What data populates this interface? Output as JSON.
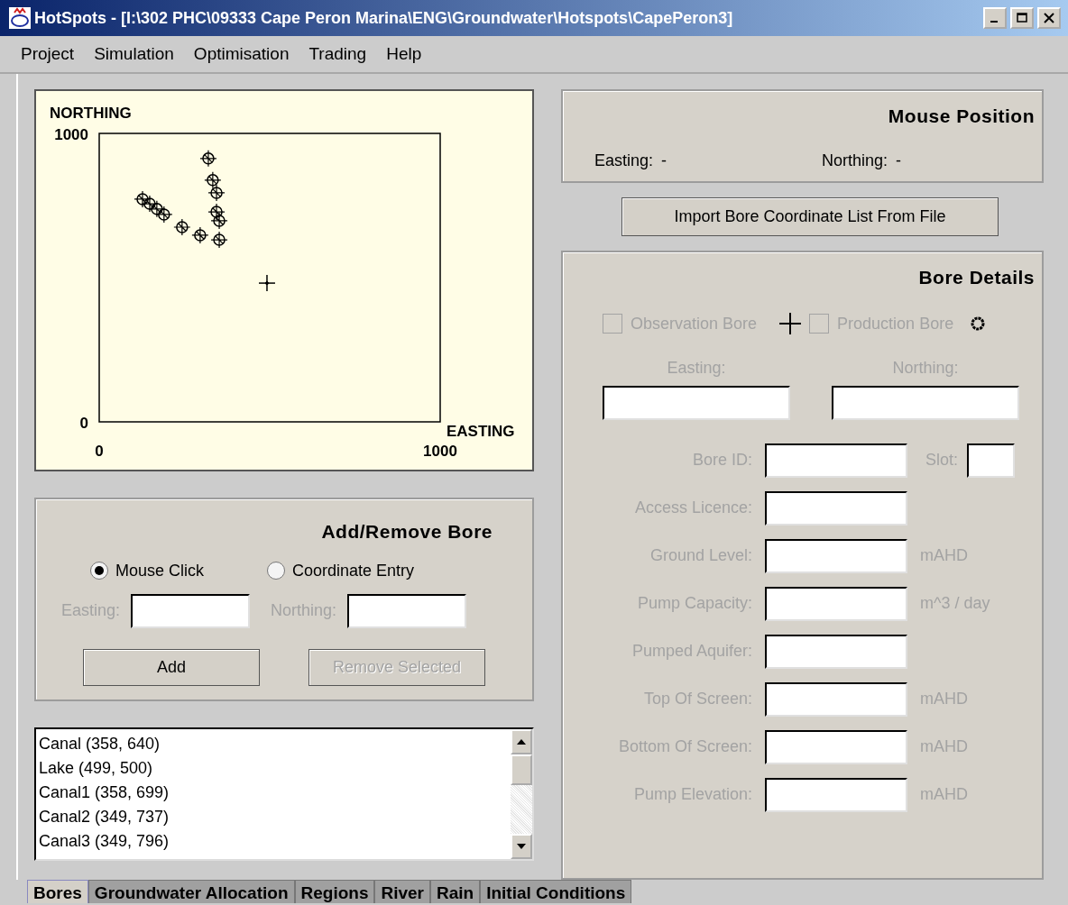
{
  "window": {
    "title": "HotSpots - [I:\\302 PHC\\09333 Cape Peron Marina\\ENG\\Groundwater\\Hotspots\\CapePeron3]"
  },
  "menu": [
    "Project",
    "Simulation",
    "Optimisation",
    "Trading",
    "Help"
  ],
  "plot": {
    "chart_data": {
      "type": "scatter",
      "xlabel": "EASTING",
      "ylabel": "NORTHING",
      "xlim": [
        0,
        1000
      ],
      "ylim": [
        0,
        1000
      ],
      "xticks": [
        0,
        1000
      ],
      "yticks": [
        0,
        1000
      ],
      "series": [
        {
          "color": "#000000",
          "x": [
            320,
            333,
            344,
            344,
            352,
            352,
            296,
            243,
            190,
            169,
            148,
            127
          ],
          "values": [
            913,
            838,
            794,
            728,
            697,
            631,
            647,
            675,
            719,
            738,
            756,
            772
          ]
        },
        {
          "color": "#000000",
          "x": [
            492
          ],
          "values": [
            481
          ]
        }
      ]
    },
    "markers": [
      {
        "kind": "production"
      },
      {
        "kind": "observation"
      }
    ]
  },
  "add_remove": {
    "title": "Add/Remove Bore",
    "modes": [
      {
        "label": "Mouse Click",
        "selected": true
      },
      {
        "label": "Coordinate Entry",
        "selected": false
      }
    ],
    "coordinates_disabled": true,
    "easting_label": "Easting:",
    "northing_label": "Northing:",
    "buttons": [
      {
        "label": "Add",
        "disabled": false
      },
      {
        "label": "Remove Selected",
        "disabled": true
      }
    ]
  },
  "bore_list": {
    "items": [
      "Canal (358, 640)",
      "Lake (499, 500)",
      "Canal1 (358, 699)",
      "Canal2 (349, 737)",
      "Canal3 (349, 796)"
    ]
  },
  "mouse_position": {
    "title": "Mouse Position",
    "easting_label": "Easting:",
    "easting": "-",
    "northing_label": "Northing:",
    "northing": "-"
  },
  "import_button": "Import Bore Coordinate List From File",
  "bore_details": {
    "title": "Bore Details",
    "disabled": true,
    "bore_types": [
      {
        "label": "Observation Bore",
        "checked": false,
        "kind": "observation"
      },
      {
        "label": "Production Bore",
        "checked": false,
        "kind": "production"
      }
    ],
    "easting_label": "Easting:",
    "northing_label": "Northing:",
    "fields": [
      {
        "label": "Bore ID:",
        "slot_label": "Slot:"
      },
      {
        "label": "Access Licence:"
      },
      {
        "label": "Ground Level:",
        "unit": "mAHD"
      },
      {
        "label": "Pump Capacity:",
        "unit": "m^3 / day"
      },
      {
        "label": "Pumped Aquifer:"
      },
      {
        "label": "Top Of Screen:",
        "unit": "mAHD"
      },
      {
        "label": "Bottom Of Screen:",
        "unit": "mAHD"
      },
      {
        "label": "Pump Elevation:",
        "unit": "mAHD"
      }
    ]
  },
  "tabs": [
    {
      "label": "Bores",
      "selected": true
    },
    {
      "label": "Groundwater Allocation",
      "selected": false
    },
    {
      "label": "Regions",
      "selected": false
    },
    {
      "label": "River",
      "selected": false
    },
    {
      "label": "Rain",
      "selected": false
    },
    {
      "label": "Initial Conditions",
      "selected": false
    }
  ]
}
